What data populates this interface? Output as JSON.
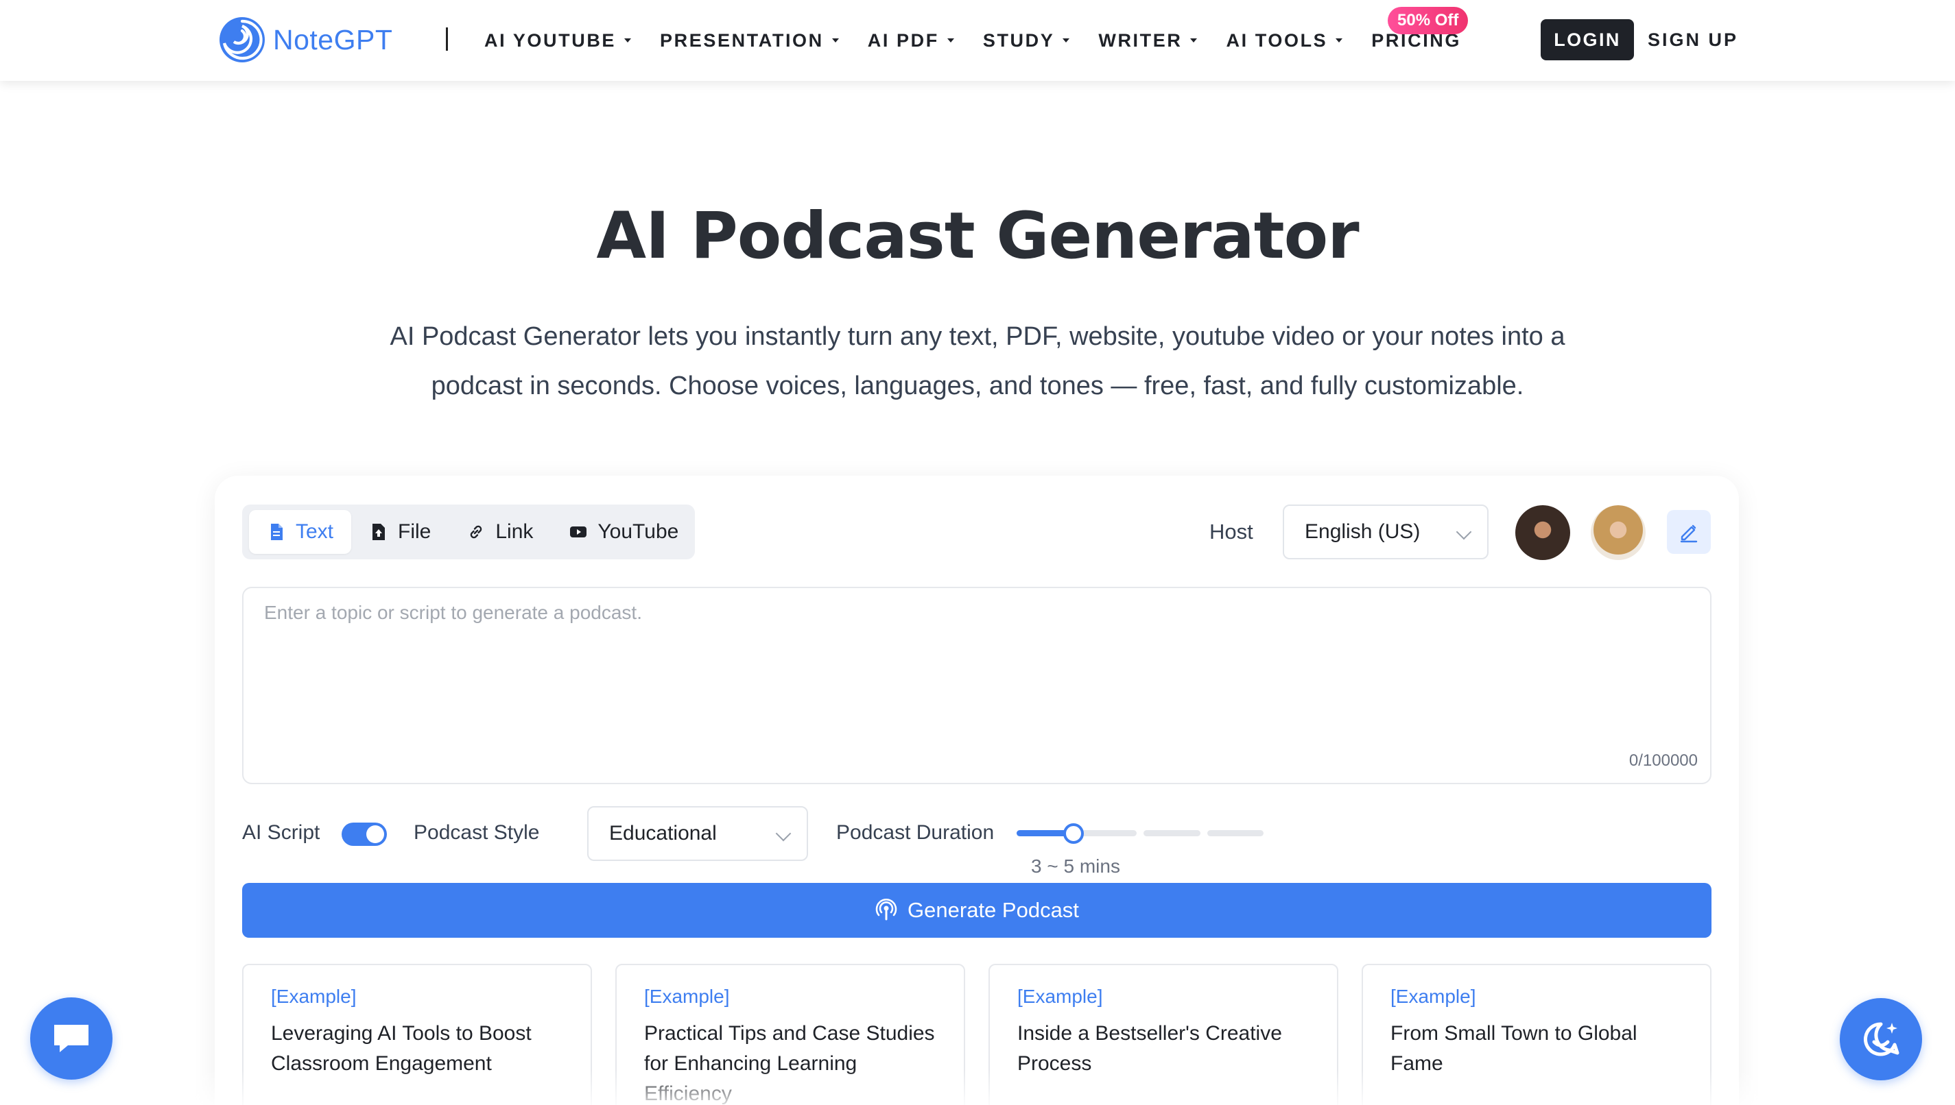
{
  "header": {
    "logo_text": "NoteGPT",
    "nav": [
      {
        "label": "AI YOUTUBE",
        "has_caret": true
      },
      {
        "label": "PRESENTATION",
        "has_caret": true
      },
      {
        "label": "AI PDF",
        "has_caret": true
      },
      {
        "label": "STUDY",
        "has_caret": true
      },
      {
        "label": "WRITER",
        "has_caret": true
      },
      {
        "label": "AI TOOLS",
        "has_caret": true
      },
      {
        "label": "PRICING",
        "has_caret": false
      }
    ],
    "pricing_badge": "50% Off",
    "login_label": "LOGIN",
    "signup_label": "SIGN UP"
  },
  "hero": {
    "title": "AI Podcast Generator",
    "description": "AI Podcast Generator lets you instantly turn any text, PDF, website, youtube video or your notes into a podcast in seconds. Choose voices, languages, and tones — free, fast, and fully customizable."
  },
  "generator": {
    "tabs": [
      {
        "label": "Text",
        "icon": "document-icon",
        "active": true
      },
      {
        "label": "File",
        "icon": "upload-icon",
        "active": false
      },
      {
        "label": "Link",
        "icon": "link-icon",
        "active": false
      },
      {
        "label": "YouTube",
        "icon": "youtube-icon",
        "active": false
      }
    ],
    "host_label": "Host",
    "language": "English (US)",
    "input_placeholder": "Enter a topic or script to generate a podcast.",
    "input_value": "",
    "char_counter": "0/100000",
    "ai_script_label": "AI Script",
    "ai_script_enabled": true,
    "podcast_style_label": "Podcast Style",
    "podcast_style_value": "Educational",
    "podcast_duration_label": "Podcast Duration",
    "duration_value": "3 ~ 5 mins",
    "duration_step": 1,
    "duration_steps_total": 4,
    "generate_label": "Generate Podcast"
  },
  "examples": [
    {
      "tag": "[Example]",
      "title": "Leveraging AI Tools to Boost Classroom Engagement"
    },
    {
      "tag": "[Example]",
      "title": "Practical Tips and Case Studies for Enhancing Learning Efficiency"
    },
    {
      "tag": "[Example]",
      "title": "Inside a Bestseller's Creative Process"
    },
    {
      "tag": "[Example]",
      "title": "From Small Town to Global Fame"
    }
  ],
  "colors": {
    "accent": "#3e7ef0",
    "badge": "#f0336f",
    "dark": "#1f2228"
  }
}
